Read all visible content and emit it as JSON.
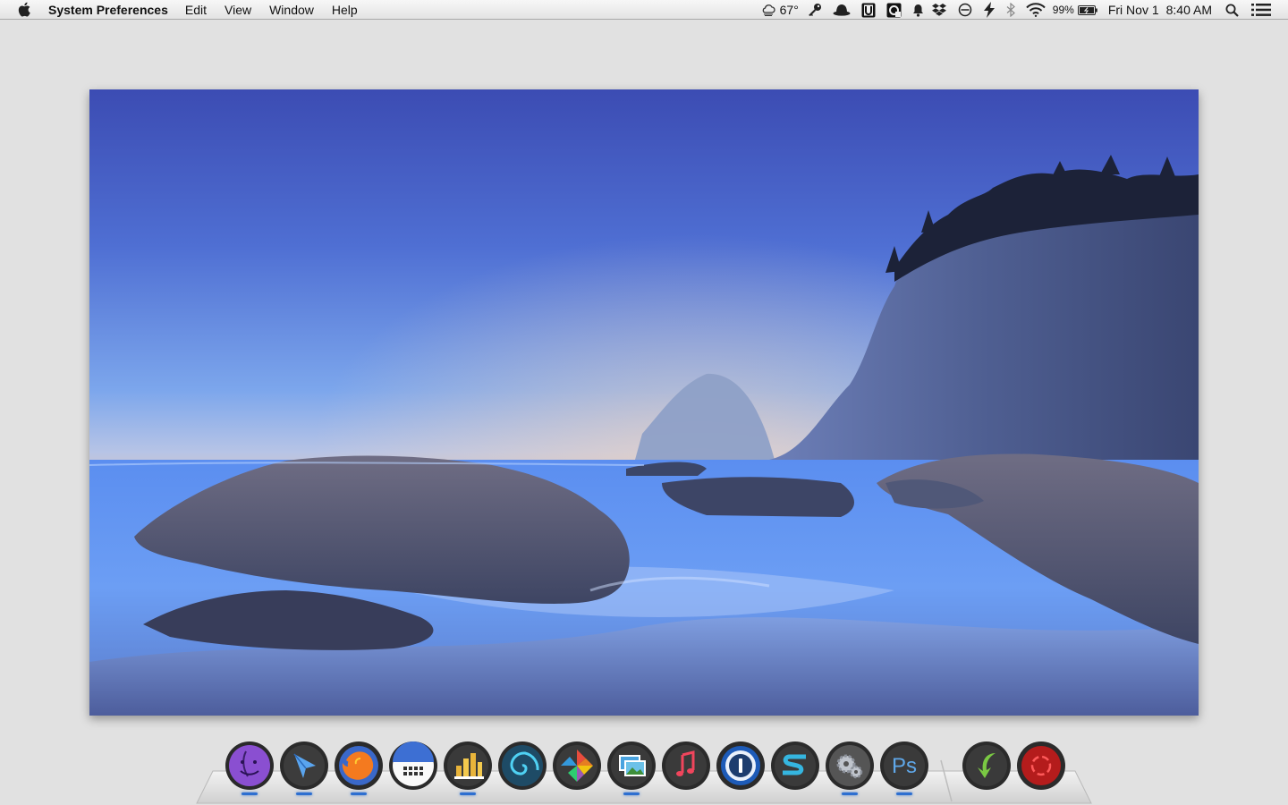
{
  "menubar": {
    "app_name": "System Preferences",
    "menus": [
      "Edit",
      "View",
      "Window",
      "Help"
    ],
    "status": {
      "weather": "67°",
      "battery": "99%",
      "date": "Fri Nov 1",
      "time": "8:40 AM"
    },
    "status_icons": [
      "weather-icon",
      "key-icon",
      "bowler-hat-icon",
      "u-box-icon",
      "screenshot-icon",
      "bell-icon",
      "dropbox-icon",
      "do-not-disturb-icon",
      "bolt-icon",
      "bluetooth-icon",
      "wifi-icon",
      "battery-icon",
      "spotlight-icon",
      "notification-center-icon"
    ]
  },
  "desktop": {
    "picture_subject": "coastal-seascape"
  },
  "dock": {
    "apps": [
      {
        "id": "finder",
        "running": true
      },
      {
        "id": "send-to",
        "running": true
      },
      {
        "id": "firefox",
        "running": true
      },
      {
        "id": "calendar",
        "running": false
      },
      {
        "id": "chart-app",
        "running": true
      },
      {
        "id": "spiral-app",
        "running": false
      },
      {
        "id": "pinwheel-app",
        "running": false
      },
      {
        "id": "photo-app",
        "running": true
      },
      {
        "id": "music",
        "running": false
      },
      {
        "id": "1password",
        "running": false
      },
      {
        "id": "s-app",
        "running": false
      },
      {
        "id": "system-preferences",
        "running": true
      },
      {
        "id": "photoshop",
        "running": true
      },
      {
        "id": "downloads-arrow",
        "running": false
      },
      {
        "id": "trash",
        "running": false
      }
    ],
    "photoshop_label": "Ps",
    "calendar_label": ""
  },
  "colors": {
    "menubar_bg": "#ececec",
    "desktop_bg": "#e1e1e1",
    "sky_top": "#3d4fb5",
    "sky_mid": "#7aa2ea",
    "horizon_warm": "#f2c19b",
    "sea": "#4f7ee0",
    "rock": "#4a5373"
  }
}
